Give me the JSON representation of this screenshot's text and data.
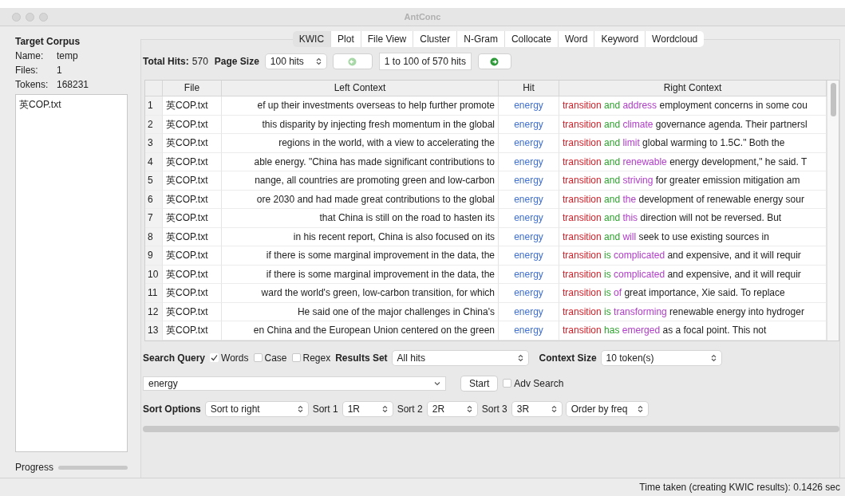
{
  "window": {
    "title": "AntConc"
  },
  "corpus": {
    "heading": "Target Corpus",
    "fields": [
      {
        "label": "Name:",
        "value": "temp"
      },
      {
        "label": "Files:",
        "value": "1"
      },
      {
        "label": "Tokens:",
        "value": "168231"
      }
    ],
    "files": [
      "英COP.txt"
    ]
  },
  "progress": {
    "label": "Progress",
    "level": 0
  },
  "tabs": [
    {
      "label": "KWIC",
      "selected": true
    },
    {
      "label": "Plot",
      "selected": false
    },
    {
      "label": "File View",
      "selected": false
    },
    {
      "label": "Cluster",
      "selected": false
    },
    {
      "label": "N-Gram",
      "selected": false
    },
    {
      "label": "Collocate",
      "selected": false
    },
    {
      "label": "Word",
      "selected": false
    },
    {
      "label": "Keyword",
      "selected": false
    },
    {
      "label": "Wordcloud",
      "selected": false
    }
  ],
  "toolbar": {
    "total_label": "Total Hits:",
    "total": "570",
    "page_size_label": "Page Size",
    "page_size": "100 hits",
    "range": "1 to 100 of 570 hits",
    "prev_disabled": true,
    "next_disabled": false
  },
  "table": {
    "columns": [
      "File",
      "Left Context",
      "Hit",
      "Right Context"
    ],
    "rows": [
      {
        "n": "1",
        "file": "英COP.txt",
        "left": "ef up their investments overseas to help further promote",
        "hit": "energy",
        "r1": "transition",
        "r2": "and",
        "r3": "address",
        "rest": "employment concerns in some cou"
      },
      {
        "n": "2",
        "file": "英COP.txt",
        "left": "this disparity by injecting fresh momentum in the global",
        "hit": "energy",
        "r1": "transition",
        "r2": "and",
        "r3": "climate",
        "rest": "governance agenda. Their partnersl"
      },
      {
        "n": "3",
        "file": "英COP.txt",
        "left": "regions in the world, with a view to accelerating the",
        "hit": "energy",
        "r1": "transition",
        "r2": "and",
        "r3": "limit",
        "rest": "global warming to 1.5C.\" Both the"
      },
      {
        "n": "4",
        "file": "英COP.txt",
        "left": "able energy. \"China has made significant contributions to",
        "hit": "energy",
        "r1": "transition",
        "r2": "and",
        "r3": "renewable",
        "rest": "energy development,\" he said. T"
      },
      {
        "n": "5",
        "file": "英COP.txt",
        "left": "nange, all countries are promoting green and low-carbon",
        "hit": "energy",
        "r1": "transition",
        "r2": "and",
        "r3": "striving",
        "rest": "for greater emission mitigation am"
      },
      {
        "n": "6",
        "file": "英COP.txt",
        "left": "ore 2030 and had made great contributions to the global",
        "hit": "energy",
        "r1": "transition",
        "r2": "and",
        "r3": "the",
        "rest": "development of renewable energy sour"
      },
      {
        "n": "7",
        "file": "英COP.txt",
        "left": "that China is still on the road to hasten its",
        "hit": "energy",
        "r1": "transition",
        "r2": "and",
        "r3": "this",
        "rest": "direction will not be reversed. But"
      },
      {
        "n": "8",
        "file": "英COP.txt",
        "left": "in his recent report, China is also focused on its",
        "hit": "energy",
        "r1": "transition",
        "r2": "and",
        "r3": "will",
        "rest": "seek to use existing sources in"
      },
      {
        "n": "9",
        "file": "英COP.txt",
        "left": "if there is some marginal improvement in the data, the",
        "hit": "energy",
        "r1": "transition",
        "r2": "is",
        "r3": "complicated",
        "rest": "and expensive, and it will requir"
      },
      {
        "n": "10",
        "file": "英COP.txt",
        "left": "if there is some marginal improvement in the data, the",
        "hit": "energy",
        "r1": "transition",
        "r2": "is",
        "r3": "complicated",
        "rest": "and expensive, and it will requir"
      },
      {
        "n": "11",
        "file": "英COP.txt",
        "left": "ward the world's green, low-carbon transition, for which",
        "hit": "energy",
        "r1": "transition",
        "r2": "is",
        "r3": "of",
        "rest": "great importance, Xie said. To replace"
      },
      {
        "n": "12",
        "file": "英COP.txt",
        "left": "He said one of the major challenges in China's",
        "hit": "energy",
        "r1": "transition",
        "r2": "is",
        "r3": "transforming",
        "rest": "renewable energy into hydroger"
      },
      {
        "n": "13",
        "file": "英COP.txt",
        "left": "en China and the European Union centered on the green",
        "hit": "energy",
        "r1": "transition",
        "r2": "has",
        "r3": "emerged",
        "rest": "as a focal point. This not"
      }
    ]
  },
  "search": {
    "label": "Search Query",
    "options": [
      {
        "label": "Words",
        "checked": true
      },
      {
        "label": "Case",
        "checked": false
      },
      {
        "label": "Regex",
        "checked": false
      }
    ],
    "results_label": "Results Set",
    "results": "All hits",
    "context_label": "Context Size",
    "context": "10 token(s)",
    "query": "energy",
    "start": "Start",
    "adv": {
      "label": "Adv Search",
      "checked": false
    }
  },
  "sort": {
    "label": "Sort Options",
    "mode": "Sort to right",
    "levels": [
      {
        "label": "Sort 1",
        "value": "1R"
      },
      {
        "label": "Sort 2",
        "value": "2R"
      },
      {
        "label": "Sort 3",
        "value": "3R"
      }
    ],
    "order": "Order by freq"
  },
  "status_bar": "Time taken (creating KWIC results):  0.1426 sec"
}
